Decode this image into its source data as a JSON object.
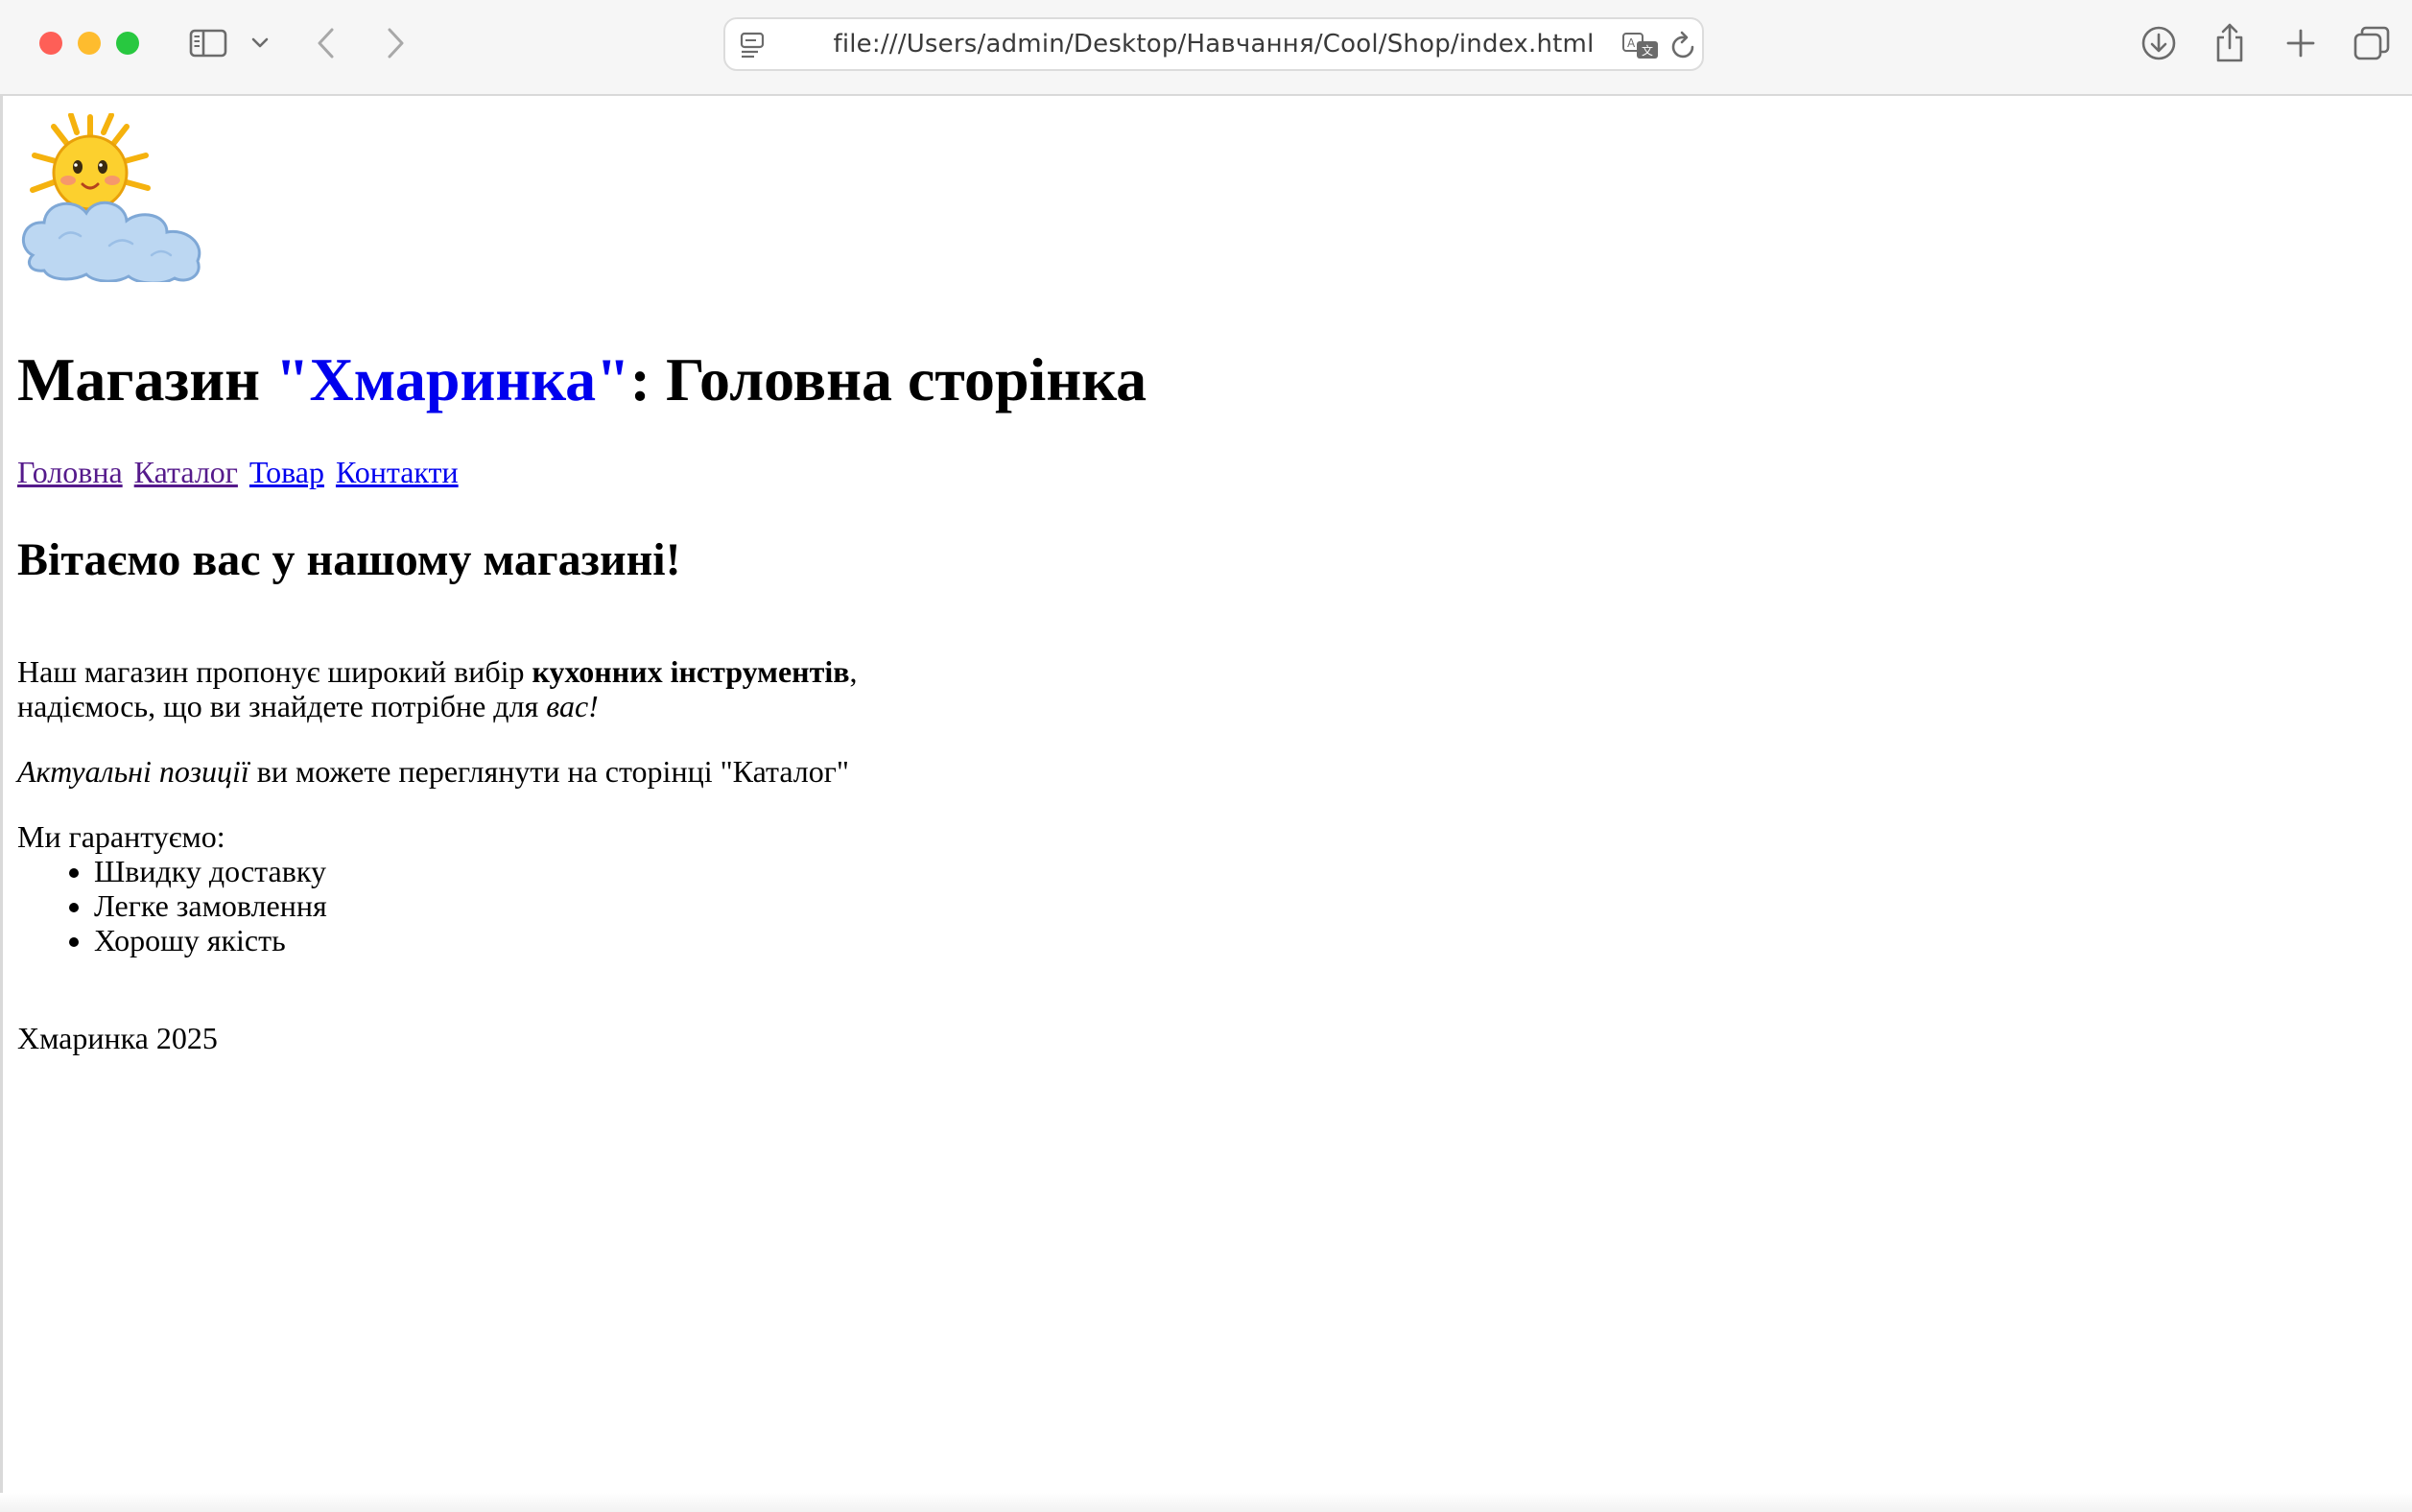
{
  "browser": {
    "url": "file:///Users/admin/Desktop/Навчання/Cool/Shop/index.html",
    "icons": {
      "sidebar": "sidebar-icon",
      "back": "chevron-left-icon",
      "forward": "chevron-right-icon",
      "download": "download-icon",
      "share": "share-icon",
      "new_tab": "plus-icon",
      "tabs": "tab-overview-icon"
    }
  },
  "page": {
    "title_prefix": "Магазин ",
    "title_brand": "\"Хмаринка\"",
    "title_suffix": ": Головна сторінка",
    "nav": [
      {
        "label": "Головна",
        "state": "visited"
      },
      {
        "label": "Каталог",
        "state": "visited"
      },
      {
        "label": "Товар",
        "state": "link"
      },
      {
        "label": "Контакти",
        "state": "link"
      }
    ],
    "welcome": "Вітаємо вас у нашому магазині!",
    "intro": {
      "part1": "Наш магазин пропонує широкий вибір ",
      "bold": "кухонних інструментів",
      "part2": ",",
      "line2": "надіємось, що ви знайдете потрібне для ",
      "italic": "вас!"
    },
    "catalog_note": {
      "italic": "Актуальні позиції",
      "rest": " ви можете переглянути на сторінці \"Каталог\""
    },
    "guarantee_intro": "Ми гарантуємо:",
    "guarantees": [
      "Швидку доставку",
      "Легке замовлення",
      "Хорошу якість"
    ],
    "footer": "Хмаринка 2025"
  },
  "colors": {
    "link": "#0000ee",
    "visited": "#551a8b",
    "brand": "#0000ee"
  }
}
